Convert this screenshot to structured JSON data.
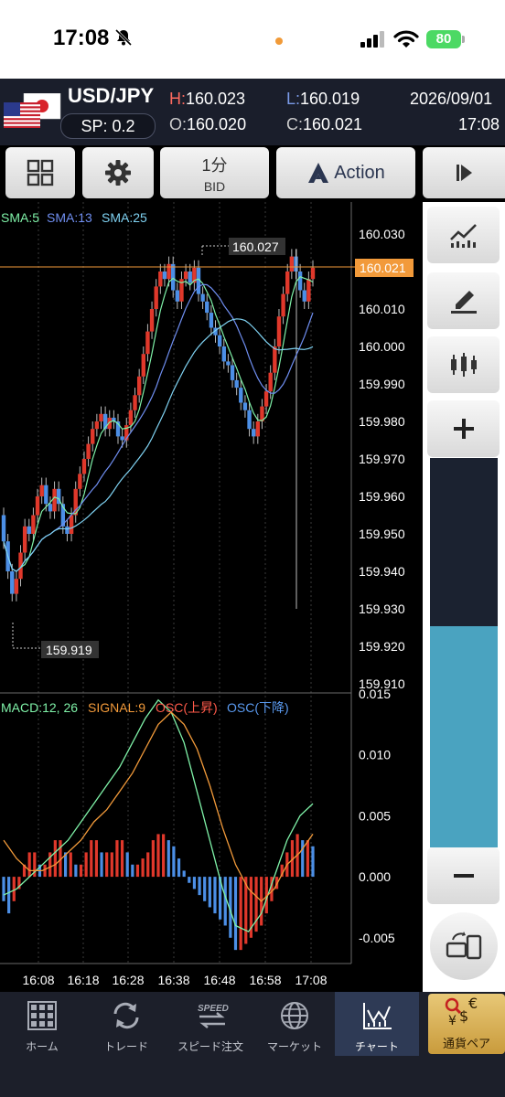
{
  "status": {
    "time": "17:08",
    "battery": "80"
  },
  "header": {
    "symbol": "USD/JPY",
    "spread": "SP: 0.2",
    "high_label": "H:",
    "high": "160.023",
    "low_label": "L:",
    "low": "160.019",
    "open_label": "O:",
    "open": "160.020",
    "close_label": "C:",
    "close": "160.021",
    "date": "2026/09/01",
    "time": "17:08"
  },
  "toolbar": {
    "timeframe": "1分",
    "price_type": "BID",
    "action": "Action"
  },
  "chart": {
    "sma_labels": [
      "SMA:5",
      "SMA:13",
      "SMA:25"
    ],
    "sma_colors": [
      "#7ff2a8",
      "#6f8ef0",
      "#7fd2f2"
    ],
    "price_ticks": [
      "160.030",
      "160.020",
      "160.010",
      "160.000",
      "159.990",
      "159.980",
      "159.970",
      "159.960",
      "159.950",
      "159.940",
      "159.930",
      "159.920",
      "159.910"
    ],
    "current_price": "160.021",
    "high_marker": "160.027",
    "low_marker": "159.919",
    "macd_labels": {
      "macd": "MACD:12, 26",
      "signal": "SIGNAL:9",
      "osc_up": "OSC(上昇)",
      "osc_down": "OSC(下降)"
    },
    "macd_ticks": [
      "0.015",
      "0.010",
      "0.005",
      "0.000",
      "-0.005"
    ],
    "time_ticks": [
      "16:08",
      "16:18",
      "16:28",
      "16:38",
      "16:48",
      "16:58",
      "17:08"
    ]
  },
  "tabs": [
    {
      "label": "ホーム",
      "icon": "home-grid-icon"
    },
    {
      "label": "トレード",
      "icon": "trade-arrows-icon"
    },
    {
      "label": "スピード注文",
      "icon": "speed-order-icon"
    },
    {
      "label": "マーケット",
      "icon": "globe-icon"
    },
    {
      "label": "チャート",
      "icon": "chart-icon"
    },
    {
      "label": "通貨ペア",
      "icon": "currency-pair-icon"
    }
  ],
  "colors": {
    "up": "#e0382b",
    "down": "#4c8fe6",
    "accent": "#f29a3a",
    "panel_fill": "#4aa3c0"
  }
}
